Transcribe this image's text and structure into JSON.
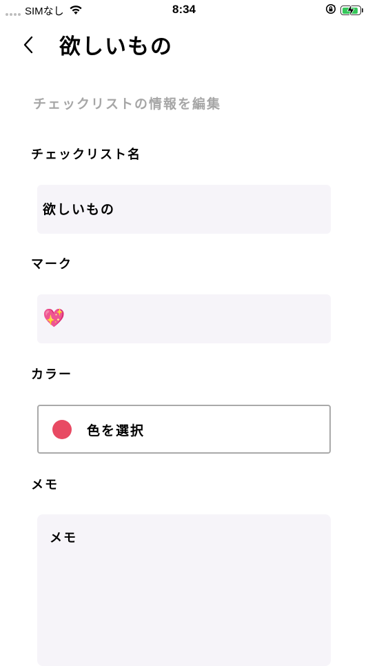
{
  "status_bar": {
    "carrier": "SIMなし",
    "time": "8:34"
  },
  "nav": {
    "title": "欲しいもの"
  },
  "section_heading": "チェックリストの情報を編集",
  "fields": {
    "name": {
      "label": "チェックリスト名",
      "value": "欲しいもの"
    },
    "mark": {
      "label": "マーク",
      "value": "💖"
    },
    "color": {
      "label": "カラー",
      "button_label": "色を選択",
      "selected_color": "#e84a63"
    },
    "memo": {
      "label": "メモ",
      "placeholder": "メモ"
    }
  },
  "icons": {
    "back": "chevron-left-icon",
    "wifi": "wifi-icon",
    "orientation_lock": "orientation-lock-icon",
    "battery": "battery-charging-icon"
  }
}
